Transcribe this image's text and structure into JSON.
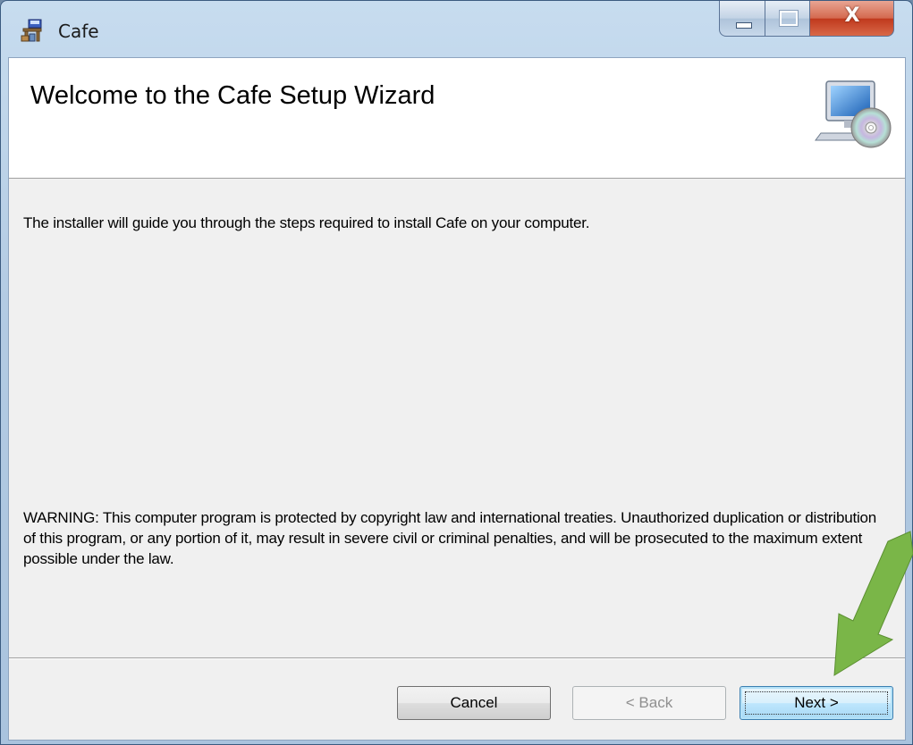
{
  "window": {
    "title": "Cafe",
    "close_glyph": "X"
  },
  "banner": {
    "title": "Welcome to the Cafe Setup Wizard",
    "icon": "computer-with-cd-icon"
  },
  "body": {
    "intro": "The installer will guide you through the steps required to install Cafe on your computer.",
    "warning": "WARNING: This computer program is protected by copyright law and international treaties. Unauthorized duplication or distribution of this program, or any portion of it, may result in severe civil or criminal penalties, and will be prosecuted to the maximum extent possible under the law."
  },
  "buttons": {
    "cancel": "Cancel",
    "back": "< Back",
    "next": "Next >"
  },
  "overlay": {
    "arrow_color": "#7ab648"
  }
}
